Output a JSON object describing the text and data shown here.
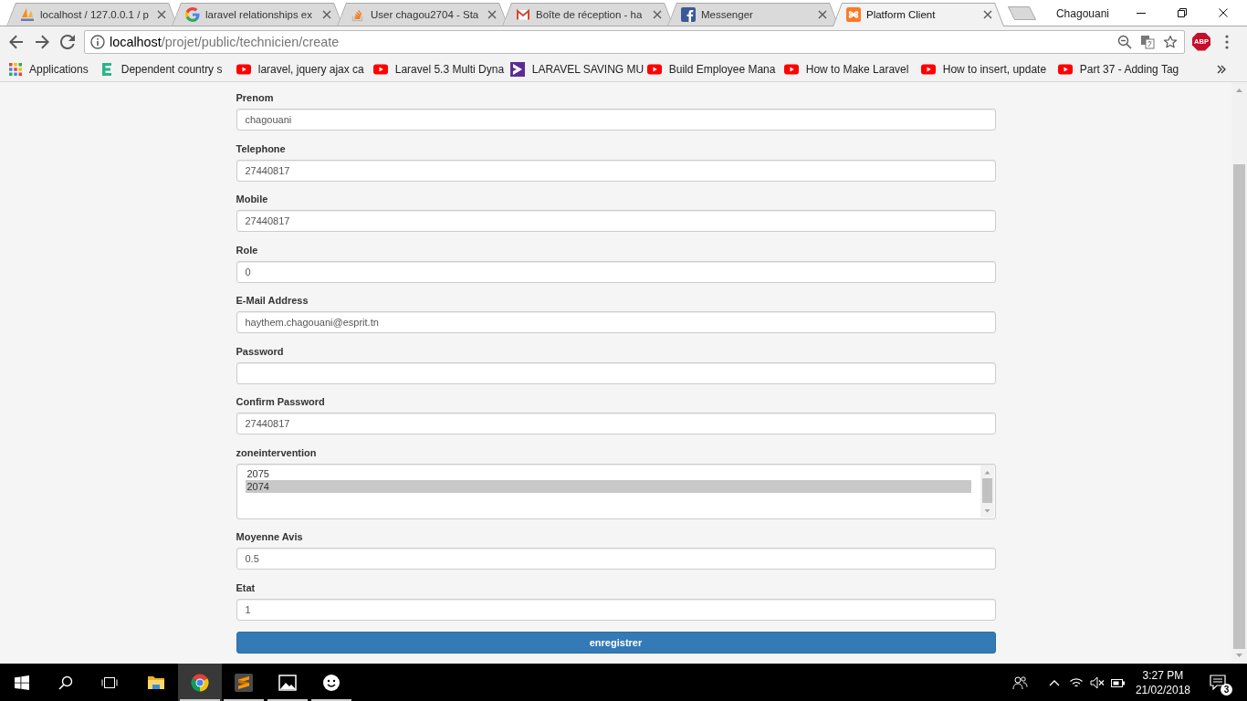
{
  "browser": {
    "tabs": [
      {
        "kind": "pma",
        "title": "localhost / 127.0.0.1 / p",
        "selected": false
      },
      {
        "kind": "google",
        "title": "laravel relationships ex",
        "selected": false
      },
      {
        "kind": "stackoverflow",
        "title": "User chagou2704 - Sta",
        "selected": false
      },
      {
        "kind": "gmail",
        "title": "Boîte de réception - ha",
        "selected": false
      },
      {
        "kind": "facebook",
        "title": "Messenger",
        "selected": false
      },
      {
        "kind": "xampp",
        "title": "Platform Client",
        "selected": true
      }
    ],
    "profile_name": "Chagouani",
    "url": {
      "host": "localhost",
      "path": "/projet/public/technicien/create"
    },
    "extension_label": "ABP",
    "bookmarks": [
      {
        "kind": "apps",
        "label": "Applications"
      },
      {
        "kind": "e_logo",
        "label": "Dependent country s"
      },
      {
        "kind": "video",
        "label": "laravel, jquery ajax ca"
      },
      {
        "kind": "video",
        "label": "Laravel 5.3 Multi Dyna"
      },
      {
        "kind": "arrow_logo",
        "label": "LARAVEL SAVING MU"
      },
      {
        "kind": "video",
        "label": "Build Employee Mana"
      },
      {
        "kind": "video",
        "label": "How to Make Laravel"
      },
      {
        "kind": "video",
        "label": "How to insert, update"
      },
      {
        "kind": "video",
        "label": "Part 37 - Adding Tag"
      }
    ]
  },
  "form": {
    "fields": [
      {
        "kind": "text",
        "label": "Prenom",
        "value": "chagouani"
      },
      {
        "kind": "text",
        "label": "Telephone",
        "value": "27440817"
      },
      {
        "kind": "text",
        "label": "Mobile",
        "value": "27440817"
      },
      {
        "kind": "text",
        "label": "Role",
        "value": "0"
      },
      {
        "kind": "text",
        "label": "E-Mail Address",
        "value": "haythem.chagouani@esprit.tn"
      },
      {
        "kind": "password",
        "label": "Password"
      },
      {
        "kind": "text",
        "label": "Confirm Password",
        "value": "27440817"
      },
      {
        "kind": "listbox",
        "label": "zoneintervention",
        "options": [
          {
            "label": "2075",
            "selected": false
          },
          {
            "label": "2074",
            "selected": true
          }
        ]
      },
      {
        "kind": "text",
        "label": "Moyenne Avis",
        "value": "0.5"
      },
      {
        "kind": "text",
        "label": "Etat",
        "value": "1"
      }
    ],
    "submit_label": "enregistrer"
  },
  "taskbar": {
    "apps": [
      {
        "kind": "explorer",
        "selected": false,
        "running": false
      },
      {
        "kind": "chrome",
        "selected": true,
        "running": true
      },
      {
        "kind": "sublime",
        "selected": false,
        "running": true
      },
      {
        "kind": "photos",
        "selected": false,
        "running": true
      },
      {
        "kind": "smiley",
        "selected": false,
        "running": true
      }
    ],
    "clock": {
      "time": "3:27 PM",
      "date": "21/02/2018"
    },
    "notification_count": "3"
  }
}
